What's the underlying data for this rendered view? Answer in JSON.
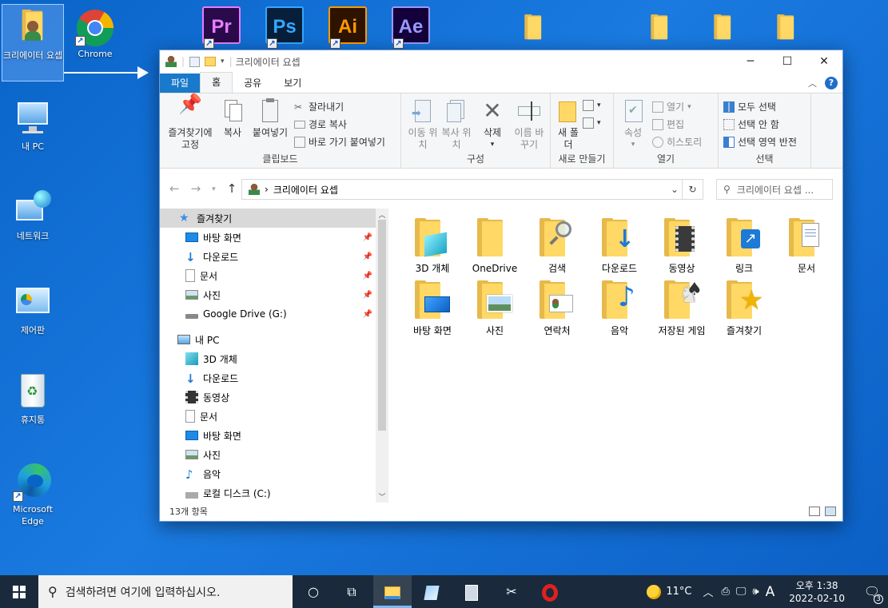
{
  "desktop": {
    "icons": [
      {
        "label": "크리에이터 요셉",
        "icon": "user-folder-icon"
      },
      {
        "label": "Chrome",
        "icon": "chrome-icon"
      },
      {
        "label": "내 PC",
        "icon": "computer-icon"
      },
      {
        "label": "네트워크",
        "icon": "network-icon"
      },
      {
        "label": "제어판",
        "icon": "control-panel-icon"
      },
      {
        "label": "휴지통",
        "icon": "recycle-bin-icon"
      },
      {
        "label": "Microsoft Edge",
        "icon": "edge-icon"
      }
    ],
    "apps": [
      {
        "label": "Pr",
        "bg": "#2a0a4a",
        "fg": "#e77cff",
        "icon": "premiere-icon"
      },
      {
        "label": "Ps",
        "bg": "#071f3a",
        "fg": "#31a8ff",
        "icon": "photoshop-icon"
      },
      {
        "label": "Ai",
        "bg": "#2e1400",
        "fg": "#ff9a00",
        "icon": "illustrator-icon"
      },
      {
        "label": "Ae",
        "bg": "#14003a",
        "fg": "#9999ff",
        "icon": "after-effects-icon"
      }
    ]
  },
  "window": {
    "title": "크리에이터 요셉",
    "tabs": [
      "파일",
      "홈",
      "공유",
      "보기"
    ],
    "ribbon": {
      "clipboard": {
        "pin": "즐겨찾기에 고정",
        "copy": "복사",
        "paste": "붙여넣기",
        "cut": "잘라내기",
        "copy_path": "경로 복사",
        "paste_shortcut": "바로 가기 붙여넣기",
        "label": "클립보드"
      },
      "organize": {
        "move_to": "이동 위치",
        "copy_to": "복사 위치",
        "delete": "삭제",
        "rename": "이름 바꾸기",
        "label": "구성"
      },
      "new": {
        "new_folder": "새 폴더",
        "label": "새로 만들기"
      },
      "open": {
        "properties": "속성",
        "open": "열기",
        "edit": "편집",
        "history": "히스토리",
        "label": "열기"
      },
      "select": {
        "select_all": "모두 선택",
        "select_none": "선택 안 함",
        "invert": "선택 영역 반전",
        "label": "선택"
      }
    },
    "address": {
      "path": "크리에이터 요셉",
      "search_placeholder": "크리에이터 요셉 ..."
    },
    "nav": {
      "quick_access": "즐겨찾기",
      "quick_items": [
        "바탕 화면",
        "다운로드",
        "문서",
        "사진",
        "Google Drive (G:)"
      ],
      "this_pc": "내 PC",
      "pc_items": [
        "3D 개체",
        "다운로드",
        "동영상",
        "문서",
        "바탕 화면",
        "사진",
        "음악",
        "로컬 디스크 (C:)"
      ]
    },
    "items": [
      {
        "label": "3D 개체",
        "overlay": "cube"
      },
      {
        "label": "OneDrive",
        "overlay": ""
      },
      {
        "label": "검색",
        "overlay": "magnifier"
      },
      {
        "label": "다운로드",
        "overlay": "download"
      },
      {
        "label": "동영상",
        "overlay": "film"
      },
      {
        "label": "링크",
        "overlay": "link"
      },
      {
        "label": "문서",
        "overlay": "doc"
      },
      {
        "label": "바탕 화면",
        "overlay": "desktop"
      },
      {
        "label": "사진",
        "overlay": "photo"
      },
      {
        "label": "연락처",
        "overlay": "contact"
      },
      {
        "label": "음악",
        "overlay": "music"
      },
      {
        "label": "저장된 게임",
        "overlay": "chess"
      },
      {
        "label": "즐겨찾기",
        "overlay": "star"
      }
    ],
    "status": "13개 항목"
  },
  "taskbar": {
    "search_placeholder": "검색하려면 여기에 입력하십시오.",
    "weather": "11°C",
    "ime": "A",
    "time": "오후 1:38",
    "date": "2022-02-10",
    "notifications": "3"
  }
}
